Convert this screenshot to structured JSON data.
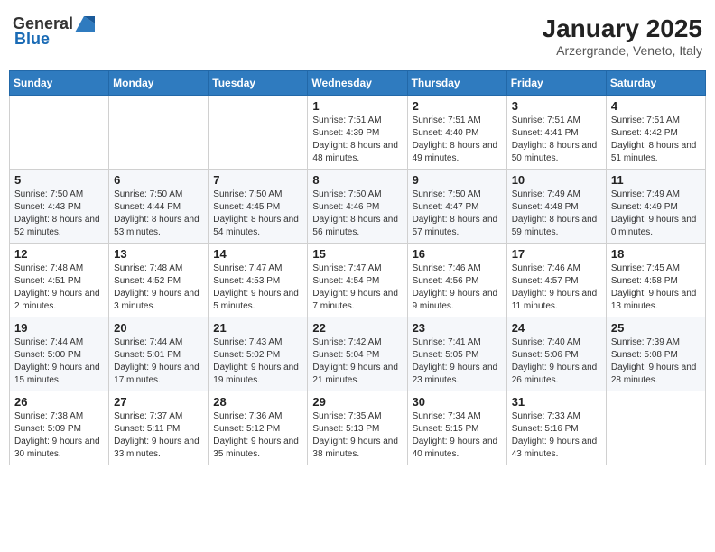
{
  "header": {
    "logo_general": "General",
    "logo_blue": "Blue",
    "month": "January 2025",
    "location": "Arzergrande, Veneto, Italy"
  },
  "weekdays": [
    "Sunday",
    "Monday",
    "Tuesday",
    "Wednesday",
    "Thursday",
    "Friday",
    "Saturday"
  ],
  "weeks": [
    [
      {
        "day": "",
        "sunrise": "",
        "sunset": "",
        "daylight": ""
      },
      {
        "day": "",
        "sunrise": "",
        "sunset": "",
        "daylight": ""
      },
      {
        "day": "",
        "sunrise": "",
        "sunset": "",
        "daylight": ""
      },
      {
        "day": "1",
        "sunrise": "Sunrise: 7:51 AM",
        "sunset": "Sunset: 4:39 PM",
        "daylight": "Daylight: 8 hours and 48 minutes."
      },
      {
        "day": "2",
        "sunrise": "Sunrise: 7:51 AM",
        "sunset": "Sunset: 4:40 PM",
        "daylight": "Daylight: 8 hours and 49 minutes."
      },
      {
        "day": "3",
        "sunrise": "Sunrise: 7:51 AM",
        "sunset": "Sunset: 4:41 PM",
        "daylight": "Daylight: 8 hours and 50 minutes."
      },
      {
        "day": "4",
        "sunrise": "Sunrise: 7:51 AM",
        "sunset": "Sunset: 4:42 PM",
        "daylight": "Daylight: 8 hours and 51 minutes."
      }
    ],
    [
      {
        "day": "5",
        "sunrise": "Sunrise: 7:50 AM",
        "sunset": "Sunset: 4:43 PM",
        "daylight": "Daylight: 8 hours and 52 minutes."
      },
      {
        "day": "6",
        "sunrise": "Sunrise: 7:50 AM",
        "sunset": "Sunset: 4:44 PM",
        "daylight": "Daylight: 8 hours and 53 minutes."
      },
      {
        "day": "7",
        "sunrise": "Sunrise: 7:50 AM",
        "sunset": "Sunset: 4:45 PM",
        "daylight": "Daylight: 8 hours and 54 minutes."
      },
      {
        "day": "8",
        "sunrise": "Sunrise: 7:50 AM",
        "sunset": "Sunset: 4:46 PM",
        "daylight": "Daylight: 8 hours and 56 minutes."
      },
      {
        "day": "9",
        "sunrise": "Sunrise: 7:50 AM",
        "sunset": "Sunset: 4:47 PM",
        "daylight": "Daylight: 8 hours and 57 minutes."
      },
      {
        "day": "10",
        "sunrise": "Sunrise: 7:49 AM",
        "sunset": "Sunset: 4:48 PM",
        "daylight": "Daylight: 8 hours and 59 minutes."
      },
      {
        "day": "11",
        "sunrise": "Sunrise: 7:49 AM",
        "sunset": "Sunset: 4:49 PM",
        "daylight": "Daylight: 9 hours and 0 minutes."
      }
    ],
    [
      {
        "day": "12",
        "sunrise": "Sunrise: 7:48 AM",
        "sunset": "Sunset: 4:51 PM",
        "daylight": "Daylight: 9 hours and 2 minutes."
      },
      {
        "day": "13",
        "sunrise": "Sunrise: 7:48 AM",
        "sunset": "Sunset: 4:52 PM",
        "daylight": "Daylight: 9 hours and 3 minutes."
      },
      {
        "day": "14",
        "sunrise": "Sunrise: 7:47 AM",
        "sunset": "Sunset: 4:53 PM",
        "daylight": "Daylight: 9 hours and 5 minutes."
      },
      {
        "day": "15",
        "sunrise": "Sunrise: 7:47 AM",
        "sunset": "Sunset: 4:54 PM",
        "daylight": "Daylight: 9 hours and 7 minutes."
      },
      {
        "day": "16",
        "sunrise": "Sunrise: 7:46 AM",
        "sunset": "Sunset: 4:56 PM",
        "daylight": "Daylight: 9 hours and 9 minutes."
      },
      {
        "day": "17",
        "sunrise": "Sunrise: 7:46 AM",
        "sunset": "Sunset: 4:57 PM",
        "daylight": "Daylight: 9 hours and 11 minutes."
      },
      {
        "day": "18",
        "sunrise": "Sunrise: 7:45 AM",
        "sunset": "Sunset: 4:58 PM",
        "daylight": "Daylight: 9 hours and 13 minutes."
      }
    ],
    [
      {
        "day": "19",
        "sunrise": "Sunrise: 7:44 AM",
        "sunset": "Sunset: 5:00 PM",
        "daylight": "Daylight: 9 hours and 15 minutes."
      },
      {
        "day": "20",
        "sunrise": "Sunrise: 7:44 AM",
        "sunset": "Sunset: 5:01 PM",
        "daylight": "Daylight: 9 hours and 17 minutes."
      },
      {
        "day": "21",
        "sunrise": "Sunrise: 7:43 AM",
        "sunset": "Sunset: 5:02 PM",
        "daylight": "Daylight: 9 hours and 19 minutes."
      },
      {
        "day": "22",
        "sunrise": "Sunrise: 7:42 AM",
        "sunset": "Sunset: 5:04 PM",
        "daylight": "Daylight: 9 hours and 21 minutes."
      },
      {
        "day": "23",
        "sunrise": "Sunrise: 7:41 AM",
        "sunset": "Sunset: 5:05 PM",
        "daylight": "Daylight: 9 hours and 23 minutes."
      },
      {
        "day": "24",
        "sunrise": "Sunrise: 7:40 AM",
        "sunset": "Sunset: 5:06 PM",
        "daylight": "Daylight: 9 hours and 26 minutes."
      },
      {
        "day": "25",
        "sunrise": "Sunrise: 7:39 AM",
        "sunset": "Sunset: 5:08 PM",
        "daylight": "Daylight: 9 hours and 28 minutes."
      }
    ],
    [
      {
        "day": "26",
        "sunrise": "Sunrise: 7:38 AM",
        "sunset": "Sunset: 5:09 PM",
        "daylight": "Daylight: 9 hours and 30 minutes."
      },
      {
        "day": "27",
        "sunrise": "Sunrise: 7:37 AM",
        "sunset": "Sunset: 5:11 PM",
        "daylight": "Daylight: 9 hours and 33 minutes."
      },
      {
        "day": "28",
        "sunrise": "Sunrise: 7:36 AM",
        "sunset": "Sunset: 5:12 PM",
        "daylight": "Daylight: 9 hours and 35 minutes."
      },
      {
        "day": "29",
        "sunrise": "Sunrise: 7:35 AM",
        "sunset": "Sunset: 5:13 PM",
        "daylight": "Daylight: 9 hours and 38 minutes."
      },
      {
        "day": "30",
        "sunrise": "Sunrise: 7:34 AM",
        "sunset": "Sunset: 5:15 PM",
        "daylight": "Daylight: 9 hours and 40 minutes."
      },
      {
        "day": "31",
        "sunrise": "Sunrise: 7:33 AM",
        "sunset": "Sunset: 5:16 PM",
        "daylight": "Daylight: 9 hours and 43 minutes."
      },
      {
        "day": "",
        "sunrise": "",
        "sunset": "",
        "daylight": ""
      }
    ]
  ]
}
